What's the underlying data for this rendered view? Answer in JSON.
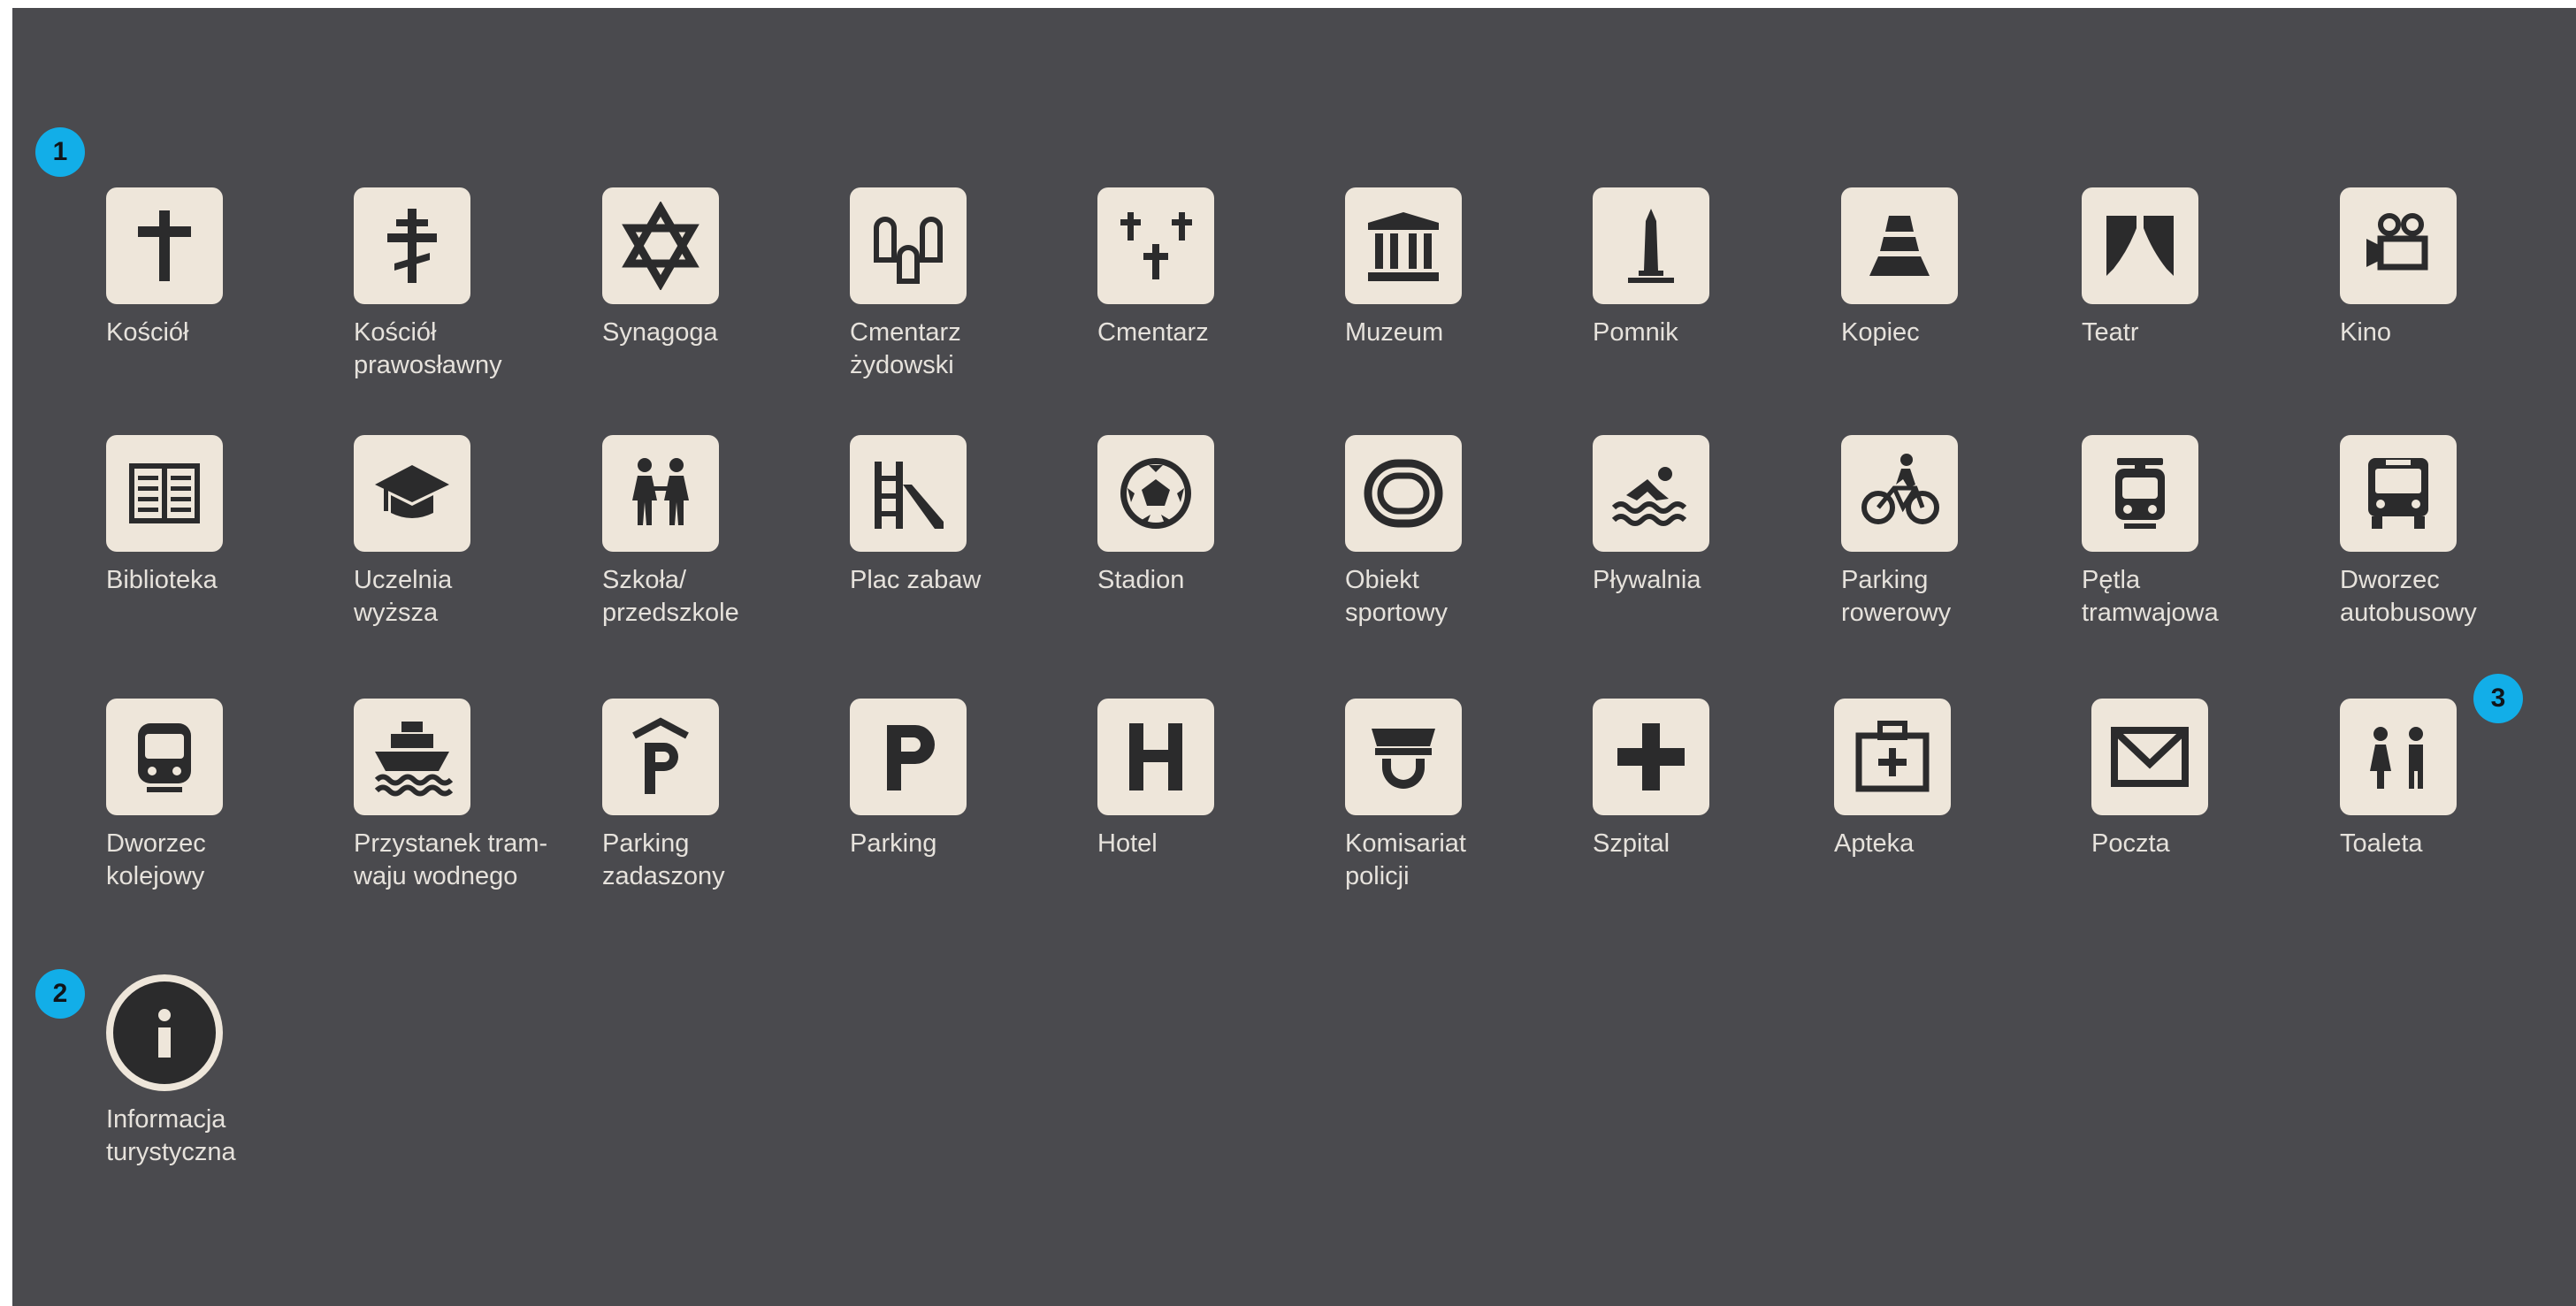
{
  "badges": [
    "1",
    "2",
    "3"
  ],
  "colors": {
    "background": "#4a4a4e",
    "tile": "#eee6da",
    "icon": "#2b2b2c",
    "label": "#e6e2dc",
    "badge": "#12aee8"
  },
  "items": [
    {
      "label": "Kościół",
      "icon": "church-cross-icon"
    },
    {
      "label": "Kościół\nprawosławny",
      "icon": "orthodox-cross-icon"
    },
    {
      "label": "Synagoga",
      "icon": "star-of-david-icon"
    },
    {
      "label": "Cmentarz\nżydowski",
      "icon": "jewish-cemetery-icon"
    },
    {
      "label": "Cmentarz",
      "icon": "cemetery-crosses-icon"
    },
    {
      "label": "Muzeum",
      "icon": "museum-icon"
    },
    {
      "label": "Pomnik",
      "icon": "monument-icon"
    },
    {
      "label": "Kopiec",
      "icon": "mound-icon"
    },
    {
      "label": "Teatr",
      "icon": "theatre-curtain-icon"
    },
    {
      "label": "Kino",
      "icon": "movie-camera-icon"
    },
    {
      "label": "Biblioteka",
      "icon": "book-icon"
    },
    {
      "label": "Uczelnia\nwyższa",
      "icon": "graduation-cap-icon"
    },
    {
      "label": "Szkoła/\nprzedszkole",
      "icon": "school-children-icon"
    },
    {
      "label": "Plac zabaw",
      "icon": "playground-slide-icon"
    },
    {
      "label": "Stadion",
      "icon": "football-icon"
    },
    {
      "label": "Obiekt\nsportowy",
      "icon": "sports-track-icon"
    },
    {
      "label": "Pływalnia",
      "icon": "swimmer-icon"
    },
    {
      "label": "Parking\nrowerowy",
      "icon": "bicycle-icon"
    },
    {
      "label": "Pętla\ntramwajowa",
      "icon": "tram-icon"
    },
    {
      "label": "Dworzec\nautobusowy",
      "icon": "bus-icon"
    },
    {
      "label": "Dworzec\nkolejowy",
      "icon": "train-icon"
    },
    {
      "label": "Przystanek tram-\nwaju wodnego",
      "icon": "water-tram-icon"
    },
    {
      "label": "Parking\nzadaszony",
      "icon": "covered-parking-icon"
    },
    {
      "label": "Parking",
      "icon": "parking-icon"
    },
    {
      "label": "Hotel",
      "icon": "hotel-icon"
    },
    {
      "label": "Komisariat\npolicji",
      "icon": "police-cap-icon"
    },
    {
      "label": "Szpital",
      "icon": "hospital-cross-icon"
    },
    {
      "label": "Apteka",
      "icon": "pharmacy-kit-icon"
    },
    {
      "label": "Poczta",
      "icon": "envelope-icon"
    },
    {
      "label": "Toaleta",
      "icon": "toilet-icon"
    },
    {
      "label": "Informacja\nturystyczna",
      "icon": "info-icon"
    }
  ]
}
